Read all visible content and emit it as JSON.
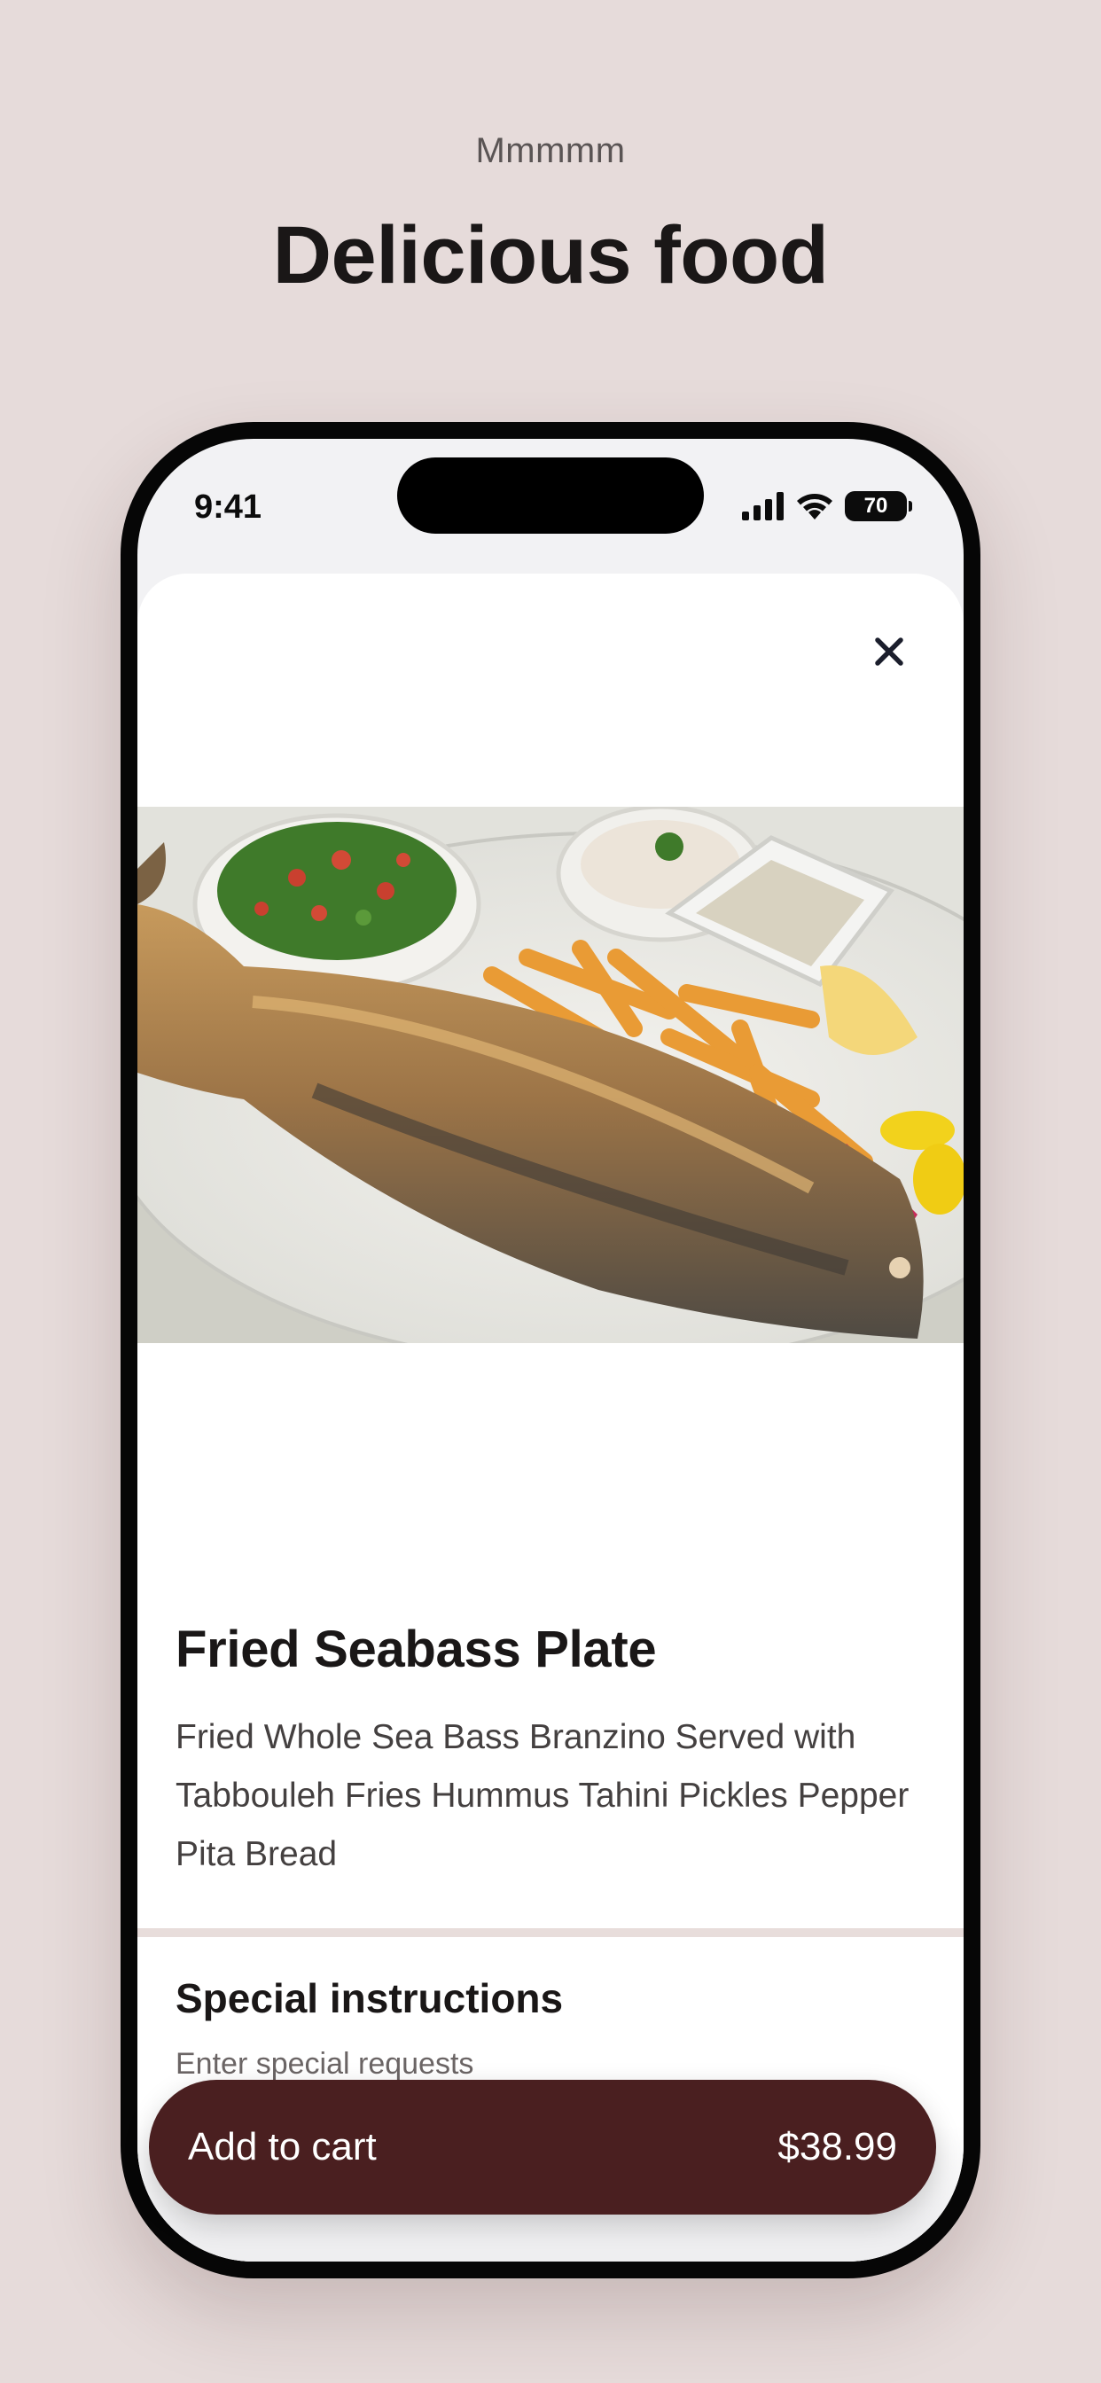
{
  "header": {
    "eyebrow": "Mmmmm",
    "title": "Delicious food"
  },
  "status_bar": {
    "time": "9:41",
    "battery": "70",
    "icons": [
      "signal-icon",
      "wifi-icon",
      "battery-icon"
    ]
  },
  "item": {
    "close_icon": "close-icon",
    "title": "Fried Seabass Plate",
    "description": "Fried Whole Sea Bass Branzino Served with Tabbouleh Fries Hummus Tahini Pickles Pepper Pita Bread"
  },
  "special_instructions": {
    "title": "Special instructions",
    "placeholder": "Enter special requests"
  },
  "cart": {
    "label": "Add to cart",
    "price": "$38.99"
  },
  "colors": {
    "background": "#e6dbda",
    "accent": "#4a1f20",
    "divider": "#e8dddb"
  }
}
